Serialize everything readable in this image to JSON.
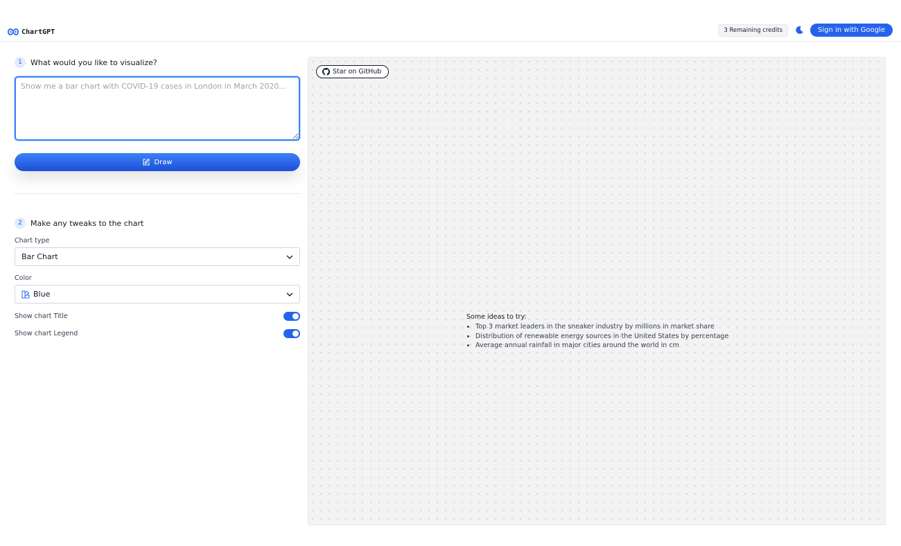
{
  "header": {
    "logo_text": "ChartGPT",
    "credits": "3 Remaining credits",
    "sign_in_label": "Sign in with Google"
  },
  "step1": {
    "number": "1",
    "title": "What would you like to visualize?",
    "prompt_placeholder": "Show me a bar chart with COVID-19 cases in London in March 2020...",
    "prompt_value": "",
    "draw_label": "Draw"
  },
  "step2": {
    "number": "2",
    "title": "Make any tweaks to the chart",
    "chart_type_label": "Chart type",
    "chart_type_value": "Bar Chart",
    "color_label": "Color",
    "color_value": "Blue",
    "show_title_label": "Show chart Title",
    "show_title_on": true,
    "show_legend_label": "Show chart Legend",
    "show_legend_on": true
  },
  "canvas": {
    "github_label": "Star on GitHub",
    "ideas_title": "Some ideas to try:",
    "ideas": [
      "Top 3 market leaders in the sneaker industry by millions in market share",
      "Distribution of renewable energy sources in the United States by percentage",
      "Average annual rainfall in major cities around the world in cm"
    ]
  },
  "colors": {
    "accent": "#2563eb",
    "canvas_bg": "#f3f3f3"
  }
}
